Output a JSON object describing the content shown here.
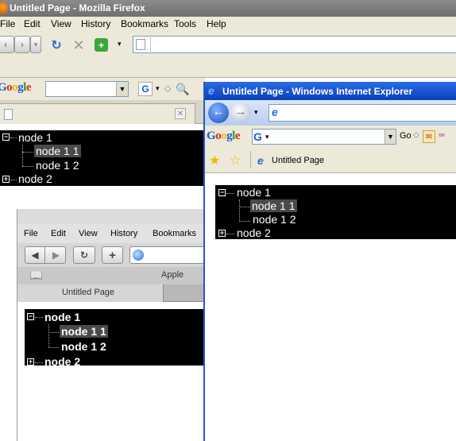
{
  "firefox": {
    "title": "Untitled Page - Mozilla Firefox",
    "menu": [
      "File",
      "Edit",
      "View",
      "History",
      "Bookmarks",
      "Tools",
      "Help"
    ],
    "tree": {
      "root1": "node 1",
      "child1": "node 1 1",
      "child2": "node 1 2",
      "root2": "node 2"
    }
  },
  "safari": {
    "menu": [
      "File",
      "Edit",
      "View",
      "History",
      "Bookmarks"
    ],
    "bookmark": "Apple",
    "tab_title": "Untitled Page",
    "tree": {
      "root1": "node 1",
      "child1": "node 1 1",
      "child2": "node 1 2",
      "root2": "node 2"
    }
  },
  "ie": {
    "title": "Untitled Page - Windows Internet Explorer",
    "go_label": "Go",
    "tab_title": "Untitled Page",
    "tree": {
      "root1": "node 1",
      "child1": "node 1 1",
      "child2": "node 1 2",
      "root2": "node 2"
    }
  },
  "google": {
    "brand": "Google"
  },
  "colors": {
    "ff_title": "#7a7a7a",
    "ie_title": "#0b3fb5",
    "tree_bg": "#000000",
    "selection": "#4a4a4a"
  }
}
